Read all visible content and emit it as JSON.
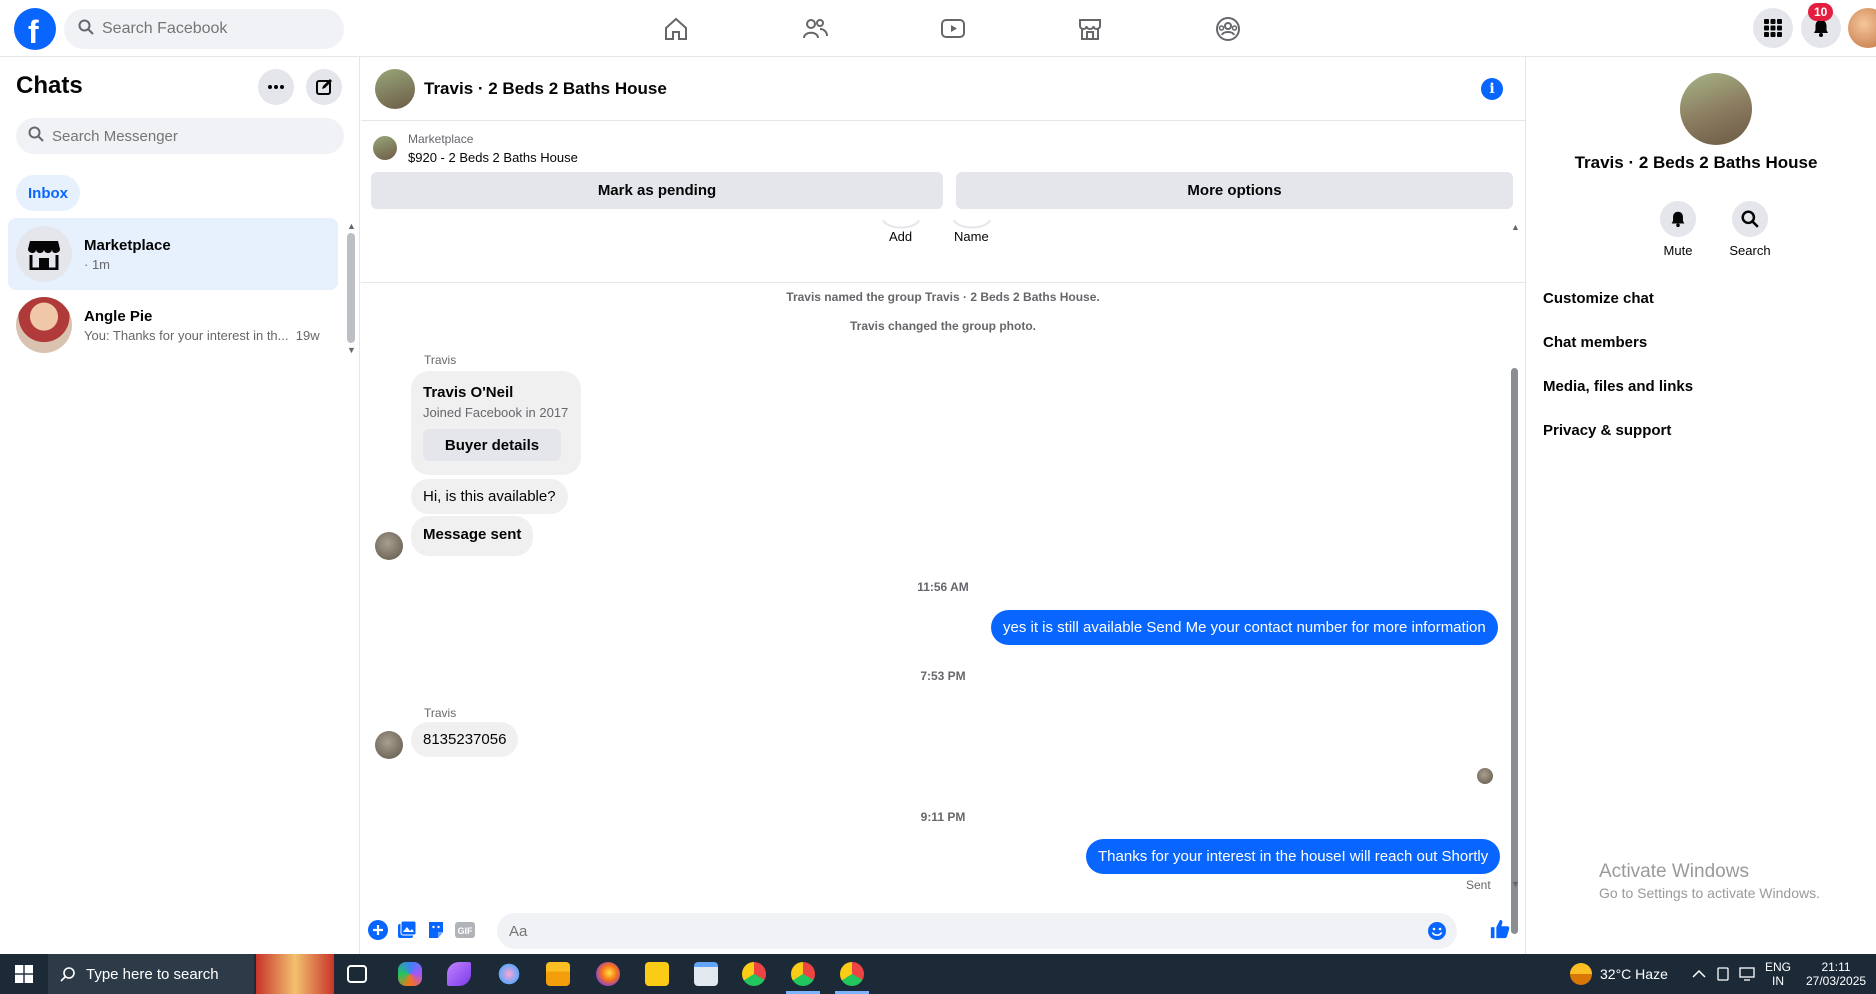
{
  "topbar": {
    "search_placeholder": "Search Facebook",
    "notification_count": "10"
  },
  "sidebar": {
    "title": "Chats",
    "search_placeholder": "Search Messenger",
    "filter_label": "Inbox",
    "conversations": [
      {
        "name": "Marketplace",
        "preview": "· 1m",
        "icon": "marketplace-store-icon"
      },
      {
        "name": "Angle Pie",
        "preview": "You: Thanks for your interest in th...",
        "time": "19w"
      }
    ]
  },
  "chat": {
    "title": "Travis · 2 Beds 2 Baths House",
    "marketplace": {
      "label": "Marketplace",
      "listing": "$920 - 2 Beds 2 Baths House",
      "pending_button": "Mark as pending",
      "more_button": "More options"
    },
    "partial_actions": [
      "Add",
      "Name"
    ],
    "system_messages": [
      "Travis named the group Travis · 2 Beds 2 Baths House.",
      "Travis changed the group photo."
    ],
    "sender_name": "Travis",
    "buyer_card": {
      "name": "Travis O'Neil",
      "joined": "Joined Facebook in 2017",
      "button": "Buyer details"
    },
    "incoming_1": "Hi, is this available?",
    "incoming_2": "Message sent",
    "time_1": "11:56 AM",
    "outgoing_1": "yes it is still available Send Me your contact number for more information",
    "time_2": "7:53 PM",
    "sender_name_2": "Travis",
    "incoming_3": "8135237056",
    "time_3": "9:11 PM",
    "outgoing_2": "Thanks for your interest in the houseI will reach out Shortly",
    "sent_status": "Sent",
    "composer_placeholder": "Aa"
  },
  "details": {
    "title": "Travis · 2 Beds 2 Baths House",
    "actions": [
      {
        "label": "Mute",
        "icon": "bell-icon"
      },
      {
        "label": "Search",
        "icon": "search-icon"
      }
    ],
    "menu": [
      "Customize chat",
      "Chat members",
      "Media, files and links",
      "Privacy & support"
    ]
  },
  "watermark": {
    "line1": "Activate Windows",
    "line2": "Go to Settings to activate Windows."
  },
  "taskbar": {
    "search_placeholder": "Type here to search",
    "weather": "32°C  Haze",
    "lang_1": "ENG",
    "lang_2": "IN",
    "clock_time": "21:11",
    "clock_date": "27/03/2025"
  },
  "colors": {
    "brand_blue": "#0866ff",
    "bubble_out": "#0866ff",
    "bubble_in": "#f0f0f0",
    "taskbar": "#1c2a38",
    "badge_red": "#e41e3f"
  }
}
